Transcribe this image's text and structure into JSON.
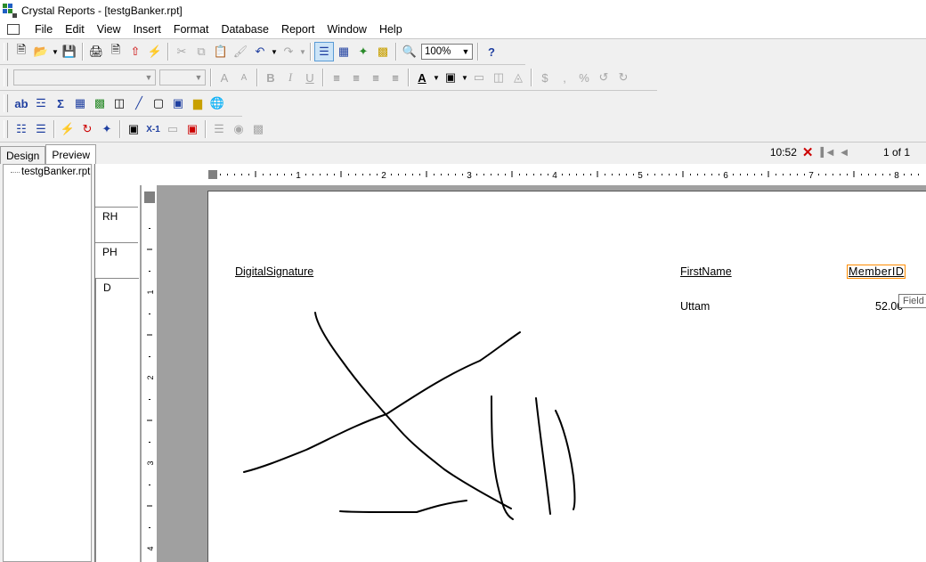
{
  "window": {
    "title": "Crystal Reports - [testgBanker.rpt]"
  },
  "menu": [
    "File",
    "Edit",
    "View",
    "Insert",
    "Format",
    "Database",
    "Report",
    "Window",
    "Help"
  ],
  "toolbar": {
    "zoom": "100%"
  },
  "tabs": {
    "design": "Design",
    "preview": "Preview"
  },
  "navigation": {
    "time": "10:52",
    "page_info": "1 of 1"
  },
  "tree": {
    "root": "testgBanker.rpt"
  },
  "sections": {
    "report_header": "RH",
    "page_header": "PH",
    "details": "D"
  },
  "ruler": {
    "top_numbers": [
      "1",
      "2",
      "3",
      "4",
      "5",
      "6",
      "7",
      "8"
    ],
    "left_numbers": [
      "1",
      "2",
      "3",
      "4"
    ]
  },
  "report": {
    "headers": {
      "digital_signature": "DigitalSignature",
      "first_name": "FirstName",
      "member_id": "MemberID"
    },
    "row": {
      "first_name": "Uttam",
      "member_id": "52.00"
    },
    "tooltip": "Field"
  },
  "colors": {
    "ink": "#000000",
    "workspace": "#a0a0a0",
    "selection_border": "#ff8c00"
  }
}
